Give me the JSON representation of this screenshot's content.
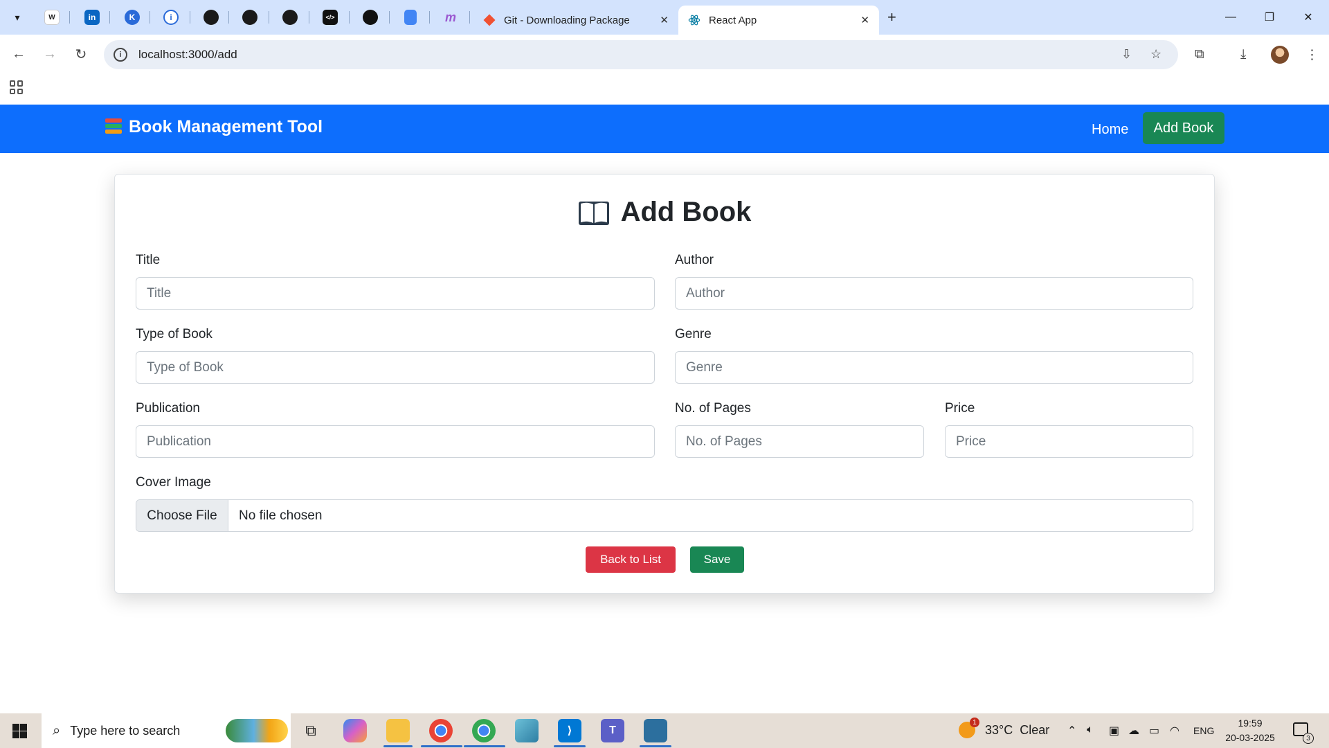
{
  "browser": {
    "tabs": [
      {
        "title": "Git - Downloading Package",
        "active": false
      },
      {
        "title": "React App",
        "active": true
      }
    ],
    "pinned_tabs": [
      {
        "icon": "wikipedia-icon",
        "label": "W",
        "color": "#ffffff"
      },
      {
        "icon": "linkedin-icon",
        "label": "in",
        "color": "#0a66c2"
      },
      {
        "icon": "kick-icon",
        "label": "K",
        "color": "#2a6ad8"
      },
      {
        "icon": "info-icon",
        "label": "i",
        "color": "#2a6ad8"
      },
      {
        "icon": "github-icon",
        "label": "",
        "color": "#1a1a1a"
      },
      {
        "icon": "github-icon",
        "label": "",
        "color": "#1a1a1a"
      },
      {
        "icon": "github-icon",
        "label": "",
        "color": "#1a1a1a"
      },
      {
        "icon": "code-icon",
        "label": "</>",
        "color": "#111111"
      },
      {
        "icon": "openai-icon",
        "label": "",
        "color": "#111111"
      },
      {
        "icon": "docs-icon",
        "label": "",
        "color": "#4285f4"
      },
      {
        "icon": "cursive-m-icon",
        "label": "m",
        "color": "#9b59d0"
      }
    ],
    "url": "localhost:3000/add"
  },
  "app": {
    "brand": "Book Management Tool",
    "nav": {
      "home": "Home",
      "add_book": "Add Book"
    }
  },
  "form": {
    "heading": "Add Book",
    "fields": {
      "title": {
        "label": "Title",
        "placeholder": "Title",
        "value": ""
      },
      "author": {
        "label": "Author",
        "placeholder": "Author",
        "value": ""
      },
      "type": {
        "label": "Type of Book",
        "placeholder": "Type of Book",
        "value": ""
      },
      "genre": {
        "label": "Genre",
        "placeholder": "Genre",
        "value": ""
      },
      "publication": {
        "label": "Publication",
        "placeholder": "Publication",
        "value": ""
      },
      "pages": {
        "label": "No. of Pages",
        "placeholder": "No. of Pages",
        "value": ""
      },
      "price": {
        "label": "Price",
        "placeholder": "Price",
        "value": ""
      }
    },
    "cover": {
      "label": "Cover Image",
      "button": "Choose File",
      "status": "No file chosen"
    },
    "buttons": {
      "back": "Back to List",
      "save": "Save"
    }
  },
  "taskbar": {
    "search_placeholder": "Type here to search",
    "weather": {
      "temp": "33°C",
      "condition": "Clear",
      "badge": "1"
    },
    "language": "ENG",
    "time": "19:59",
    "date": "20-03-2025",
    "notification_count": "3"
  },
  "colors": {
    "primary": "#0d6efd",
    "success": "#198754",
    "danger": "#dc3545"
  }
}
